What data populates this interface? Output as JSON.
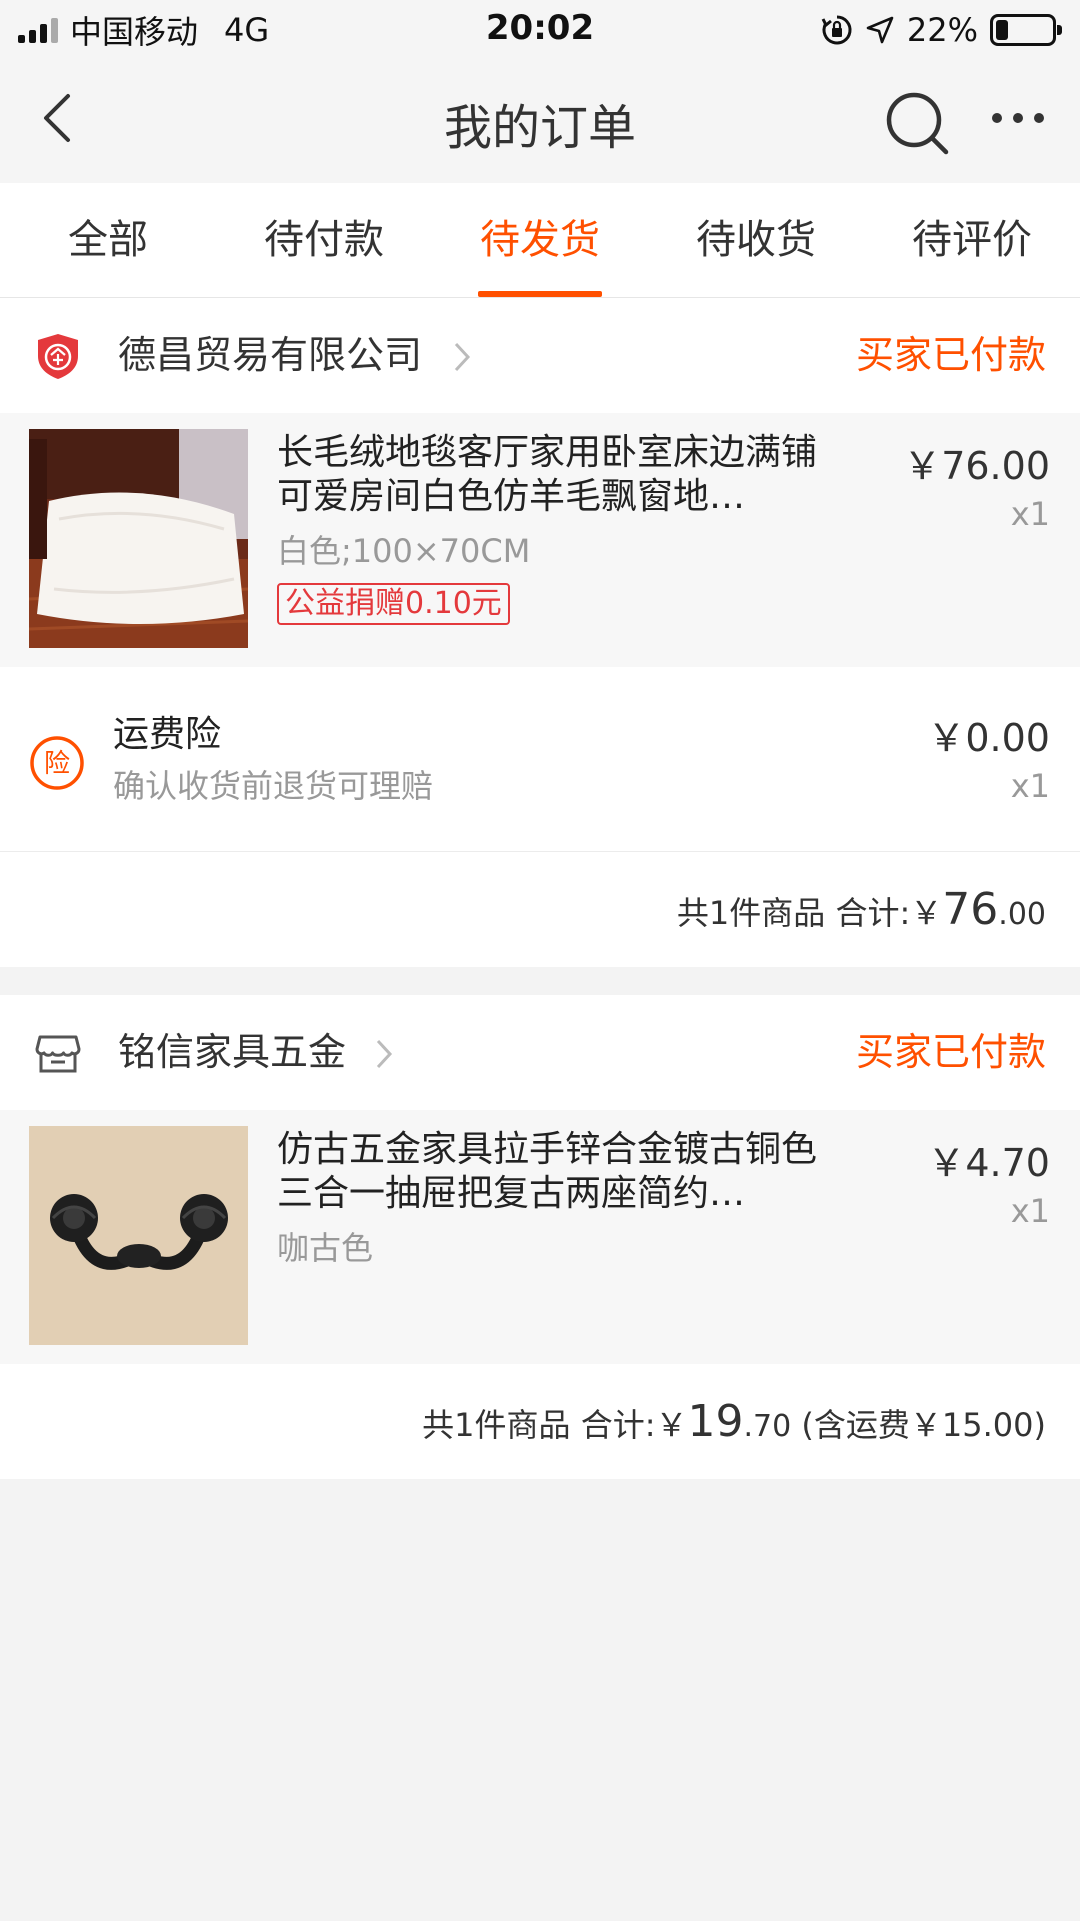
{
  "status_bar": {
    "carrier": "中国移动",
    "network": "4G",
    "time": "20:02",
    "battery_pct": "22%",
    "battery_level": 0.22
  },
  "nav": {
    "title": "我的订单",
    "back_icon": "back-arrow-icon",
    "search_icon": "search-icon",
    "more_icon": "more-icon"
  },
  "tabs": [
    {
      "label": "全部",
      "active": false
    },
    {
      "label": "待付款",
      "active": false
    },
    {
      "label": "待发货",
      "active": true
    },
    {
      "label": "待收货",
      "active": false
    },
    {
      "label": "待评价",
      "active": false
    }
  ],
  "colors": {
    "accent": "#ff5000",
    "tag_red": "#e4393c"
  },
  "orders": [
    {
      "shop_icon": "enterprise-shield-icon",
      "shop_name": "德昌贸易有限公司",
      "status": "买家已付款",
      "item": {
        "title": "长毛绒地毯客厅家用卧室床边满铺可爱房间白色仿羊毛飘窗地…",
        "sku": "白色;100×70CM",
        "tag": "公益捐赠0.10元",
        "price": "￥76.00",
        "qty": "x1"
      },
      "insurance": {
        "icon": "insurance-icon",
        "icon_char": "险",
        "title": "运费险",
        "subtitle": "确认收货前退货可理赔",
        "price": "￥0.00",
        "qty": "x1"
      },
      "total": {
        "count_label": "共1件商品",
        "sum_label": "合计:",
        "currency": "￥",
        "amount_int": "76",
        "amount_dec": ".00",
        "shipping_note": ""
      }
    },
    {
      "shop_icon": "shop-store-icon",
      "shop_name": "铭信家具五金",
      "status": "买家已付款",
      "item": {
        "title": "仿古五金家具拉手锌合金镀古铜色三合一抽屉把复古两座简约…",
        "sku": "咖古色",
        "tag": "",
        "price": "￥4.70",
        "qty": "x1"
      },
      "total": {
        "count_label": "共1件商品",
        "sum_label": "合计:",
        "currency": "￥",
        "amount_int": "19",
        "amount_dec": ".70",
        "shipping_note": "(含运费￥15.00)"
      }
    }
  ]
}
